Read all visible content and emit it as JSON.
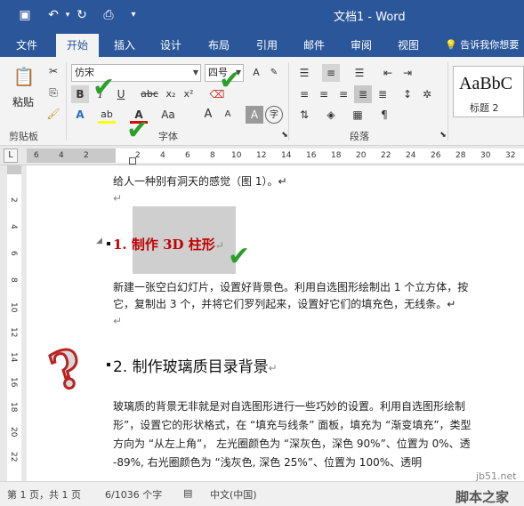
{
  "titlebar": {
    "title": "文档1 - Word",
    "qat": [
      "save-icon",
      "undo-icon",
      "redo-icon",
      "print-preview-icon",
      "customize-icon"
    ]
  },
  "tabs": [
    "文件",
    "开始",
    "插入",
    "设计",
    "布局",
    "引用",
    "邮件",
    "审阅",
    "视图"
  ],
  "tell_me": "告诉我你想要",
  "ribbon": {
    "clipboard_label": "剪贴板",
    "paste_label": "粘贴",
    "font_label": "字体",
    "font_name": "仿宋",
    "font_size": "四号",
    "paragraph_label": "段落",
    "style_sample": "AaBbC",
    "style_name": "标题 2",
    "bold": "B",
    "italic": "I",
    "underline": "U",
    "strike": "abc",
    "sub": "x₂",
    "sup": "x²",
    "text_effect": "A",
    "highlight": "ab",
    "font_color": "A",
    "change_case": "Aa",
    "grow": "A",
    "shrink": "A",
    "char_shade": "A",
    "enclose": "字"
  },
  "ruler": {
    "corner": "L",
    "numbers": [
      "6",
      "4",
      "2",
      "2",
      "4",
      "6",
      "8",
      "10",
      "12",
      "14",
      "16",
      "18",
      "20",
      "22",
      "24",
      "26",
      "28",
      "30",
      "32"
    ]
  },
  "vruler": {
    "numbers": [
      "2",
      "4",
      "6",
      "8",
      "10",
      "12",
      "14",
      "16",
      "18",
      "20",
      "22"
    ]
  },
  "document": {
    "line1": "给人一种别有洞天的感觉（图 1）。↵",
    "empty1": "↵",
    "heading1": "1.  制作 3D 柱形",
    "heading1_mark": "↵",
    "para1_l1": "新建一张空白幻灯片，设置好背景色。利用自选图形绘制出 1 个立方体，按",
    "para1_l2": "它，复制出 3 个，并将它们罗列起来，设置好它们的填充色，无线条。↵",
    "empty2": "↵",
    "heading2": "2. 制作玻璃质目录背景",
    "heading2_mark": "↵",
    "para2_l1": "玻璃质的背景无非就是对自选图形进行一些巧妙的设置。利用自选图形绘制",
    "para2_l2": "形”，设置它的形状格式，在 “填充与线条” 面板，填充为 “渐变填充”，类型",
    "para2_l3": "方向为 “从左上角”， 左光圈颜色为 “深灰色，深色 90%”、位置为 0%、透",
    "para2_l4": "-89%, 右光圈颜色为 “浅灰色, 深色 25%”、位置为 100%、透明"
  },
  "status": {
    "page": "第 1 页，共 1 页",
    "words": "6/1036 个字",
    "lang": "中文(中国)"
  },
  "watermark": {
    "site": "jb51.net",
    "name": "脚本之家"
  },
  "colors": {
    "accent": "#2b579a",
    "heading_red": "#c00000",
    "check_green": "#2aa02a"
  }
}
